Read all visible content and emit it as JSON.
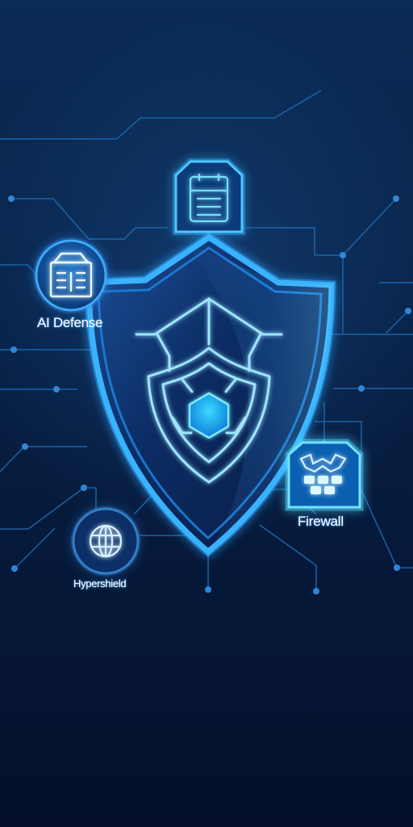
{
  "nodes": {
    "ai_defense": {
      "label": "AI Defense",
      "icon": "shield-dashboard-icon"
    },
    "firewall": {
      "label": "Firewall",
      "icon": "firewall-icon"
    },
    "hypershield": {
      "label": "Hypershield",
      "icon": "globe-icon"
    },
    "top_node": {
      "icon": "calendar-icon"
    }
  },
  "center": {
    "icon": "shield-icon"
  },
  "colors": {
    "background": "#071a3a",
    "accent": "#48bcff",
    "glow": "#6ee3ff"
  }
}
